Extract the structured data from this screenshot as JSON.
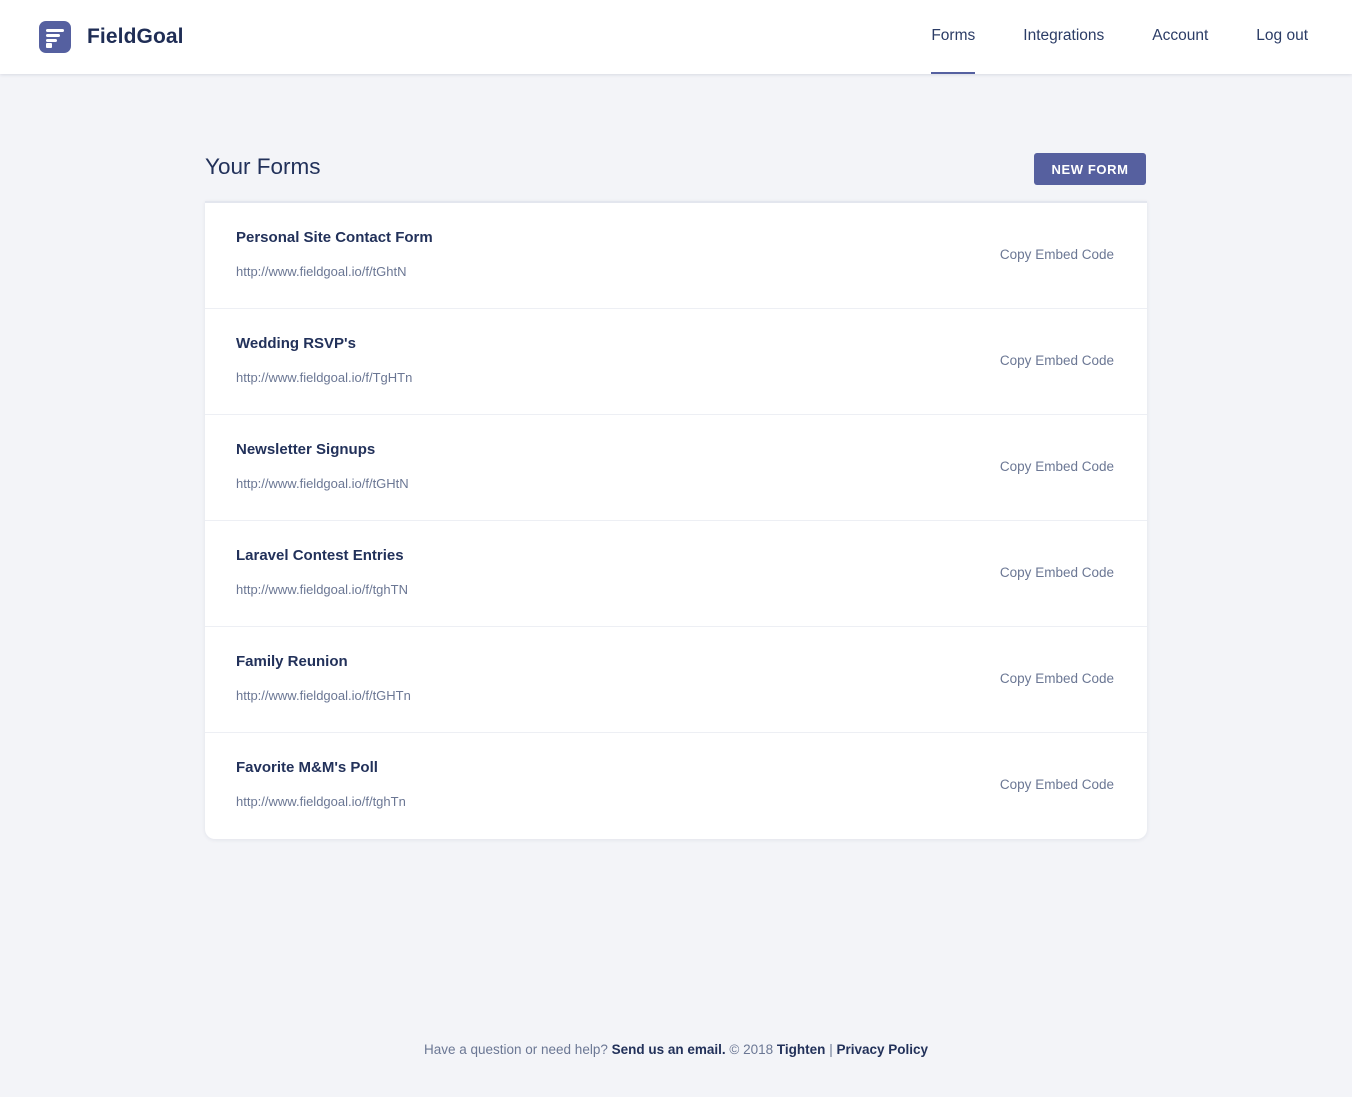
{
  "brand": {
    "name": "FieldGoal",
    "logo_icon": "form-lines-icon",
    "logo_color": "#5560a0"
  },
  "nav": {
    "items": [
      {
        "label": "Forms",
        "active": true
      },
      {
        "label": "Integrations",
        "active": false
      },
      {
        "label": "Account",
        "active": false
      },
      {
        "label": "Log out",
        "active": false
      }
    ]
  },
  "main": {
    "title": "Your Forms",
    "new_button_label": "NEW FORM",
    "accent_color": "#56609f",
    "forms": [
      {
        "name": "Personal Site Contact Form",
        "url": "http://www.fieldgoal.io/f/tGhtN",
        "action": "Copy Embed Code"
      },
      {
        "name": "Wedding RSVP's",
        "url": "http://www.fieldgoal.io/f/TgHTn",
        "action": "Copy Embed Code"
      },
      {
        "name": "Newsletter Signups",
        "url": "http://www.fieldgoal.io/f/tGHtN",
        "action": "Copy Embed Code"
      },
      {
        "name": "Laravel Contest Entries",
        "url": "http://www.fieldgoal.io/f/tghTN",
        "action": "Copy Embed Code"
      },
      {
        "name": "Family Reunion",
        "url": "http://www.fieldgoal.io/f/tGHTn",
        "action": "Copy Embed Code"
      },
      {
        "name": "Favorite M&M's Poll",
        "url": "http://www.fieldgoal.io/f/tghTn",
        "action": "Copy Embed Code"
      }
    ]
  },
  "footer": {
    "question": "Have a question or need help?",
    "email_link": "Send us an email.",
    "copyright": "© 2018",
    "company_link": "Tighten",
    "separator": "|",
    "privacy_link": "Privacy Policy"
  }
}
